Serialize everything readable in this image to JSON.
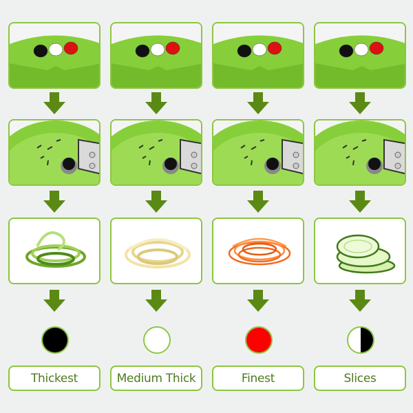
{
  "colors": {
    "accent": "#8cc63f",
    "arrow": "#5a8a14",
    "label_text": "#4e7a1c",
    "background": "#eff1f0"
  },
  "columns": [
    {
      "label": "Thickest",
      "dot": "black",
      "dot_colors": [
        "#000000"
      ]
    },
    {
      "label": "Medium Thick",
      "dot": "white",
      "dot_colors": [
        "#ffffff"
      ]
    },
    {
      "label": "Finest",
      "dot": "red",
      "dot_colors": [
        "#ff0000"
      ]
    },
    {
      "label": "Slices",
      "dot": "half-white-half-black",
      "dot_colors": [
        "#ffffff",
        "#000000"
      ]
    }
  ]
}
